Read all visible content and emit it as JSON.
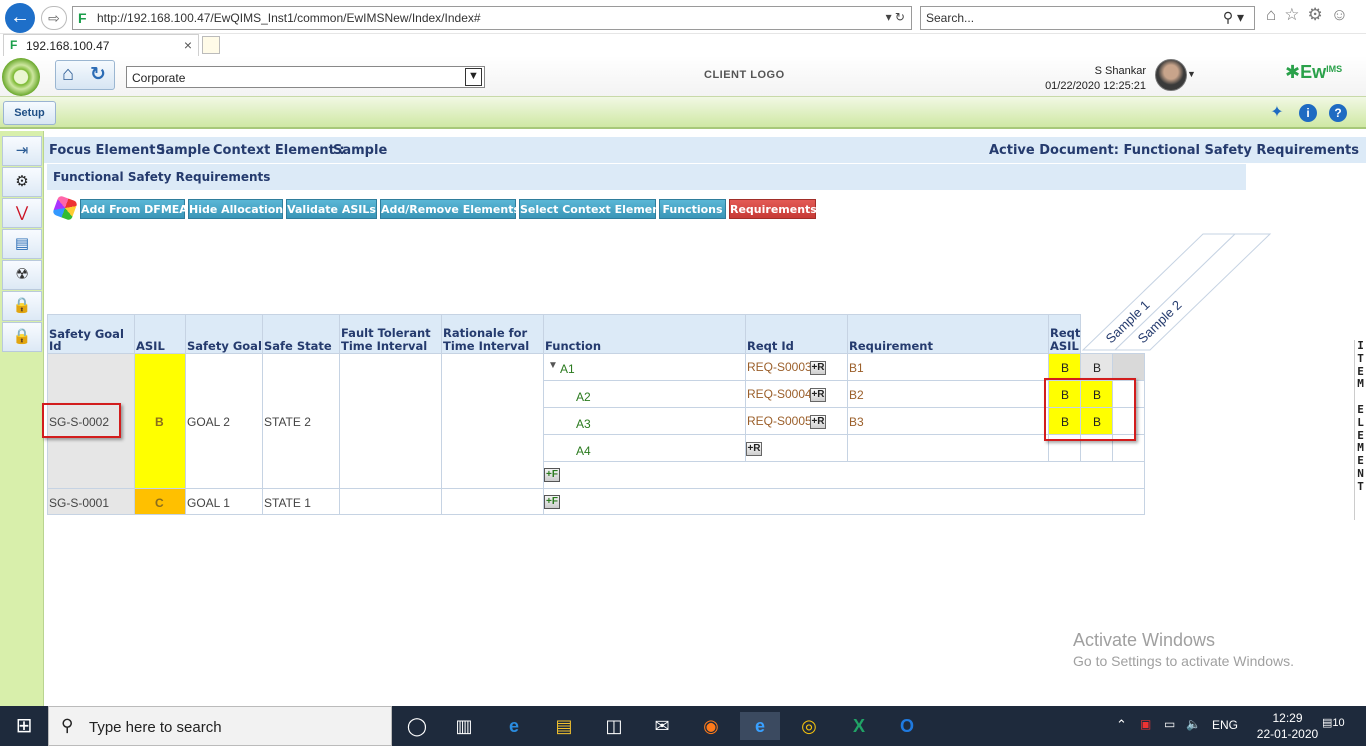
{
  "browser": {
    "url": "http://192.168.100.47/EwQIMS_Inst1/common/EwIMSNew/Index/Index#",
    "search_placeholder": "Search...",
    "tab_title": "192.168.100.47"
  },
  "header": {
    "project": "Corporate",
    "client_logo": "CLIENT LOGO",
    "user_name": "S Shankar",
    "datetime": "01/22/2020 12:25:21",
    "brand": "Ew",
    "brand_sup": "IMS",
    "brand_sub": "QMS"
  },
  "toolbar": {
    "setup_label": "Setup"
  },
  "context": {
    "focus_label": "Focus Element :",
    "focus_value": "Sample",
    "context_label": "Context Element :",
    "context_value": "Sample",
    "active_document": "Active Document: Functional Safety Requirements"
  },
  "page_title": "Functional Safety Requirements",
  "actions": [
    "Add From DFMEA",
    "Hide Allocation",
    "Validate ASILs",
    "Add/Remove Elements",
    "Select Context Element",
    "Functions",
    "Requirements"
  ],
  "table": {
    "headers": {
      "safety_goal_id": "Safety Goal Id",
      "asil": "ASIL",
      "safety_goal": "Safety Goal",
      "safe_state": "Safe State",
      "ftti_1": "Fault Tolerant",
      "ftti_2": "Time Interval",
      "rationale_1": "Rationale for",
      "rationale_2": "Time Interval",
      "function": "Function",
      "reqt_id": "Reqt Id",
      "requirement": "Requirement",
      "reqt_asil_1": "Reqt",
      "reqt_asil_2": "ASIL"
    },
    "sample_columns": [
      "Sample 1",
      "Sample 2"
    ],
    "goals": [
      {
        "id": "SG-S-0002",
        "asil": "B",
        "goal": "GOAL 2",
        "state": "STATE 2",
        "rows": [
          {
            "function": "A1",
            "reqt_id": "REQ-S0003",
            "requirement": "B1",
            "reqt_asil": "B",
            "s1": "B",
            "s2": ""
          },
          {
            "function": "A2",
            "reqt_id": "REQ-S0004",
            "requirement": "B2",
            "reqt_asil": "B",
            "s1": "B",
            "s2": ""
          },
          {
            "function": "A3",
            "reqt_id": "REQ-S0005",
            "requirement": "B3",
            "reqt_asil": "B",
            "s1": "B",
            "s2": ""
          },
          {
            "function": "A4",
            "reqt_id": "",
            "requirement": "",
            "reqt_asil": "",
            "s1": "",
            "s2": ""
          }
        ]
      },
      {
        "id": "SG-S-0001",
        "asil": "C",
        "goal": "GOAL 1",
        "state": "STATE 1",
        "rows": []
      }
    ],
    "add_req_label": "+R",
    "add_fn_label": "+F"
  },
  "side_panel_label": [
    "I",
    "T",
    "E",
    "M",
    "",
    "E",
    "L",
    "E",
    "M",
    "E",
    "N",
    "T"
  ],
  "watermark": {
    "line1": "Activate Windows",
    "line2": "Go to Settings to activate Windows."
  },
  "taskbar": {
    "search_placeholder": "Type here to search",
    "language": "ENG",
    "time": "12:29",
    "date": "22-01-2020",
    "notifications": "10"
  }
}
